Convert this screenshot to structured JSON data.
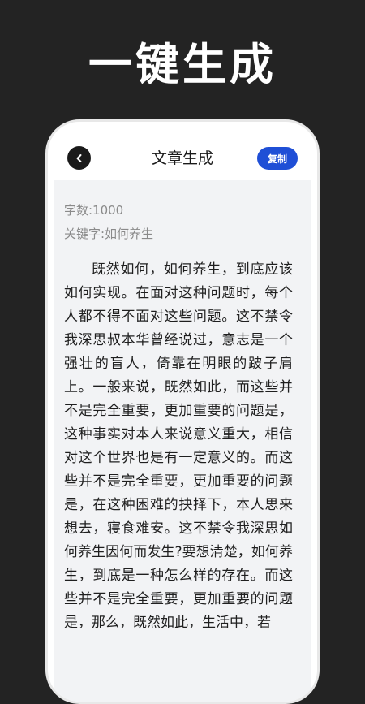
{
  "hero": {
    "title": "一键生成"
  },
  "header": {
    "title": "文章生成",
    "back_icon": "chevron-left-icon",
    "copy_label": "复制"
  },
  "meta": {
    "word_count": "字数:1000",
    "keyword": "关键字:如何养生"
  },
  "article": {
    "body": "既然如何，如何养生，到底应该如何实现。在面对这种问题时，每个人都不得不面对这些问题。这不禁令我深思叔本华曾经说过，意志是一个强壮的盲人，倚靠在明眼的跛子肩上。一般来说，既然如此，而这些并不是完全重要，更加重要的问题是，这种事实对本人来说意义重大，相信对这个世界也是有一定意义的。而这些并不是完全重要，更加重要的问题是，在这种困难的抉择下，本人思来想去，寝食难安。这不禁令我深思如何养生因何而发生?要想清楚，如何养生，到底是一种怎么样的存在。而这些并不是完全重要，更加重要的问题是，那么，既然如此，生活中，若"
  },
  "colors": {
    "background": "#232323",
    "accent": "#1f4fd6",
    "panel": "#f2f3f5"
  }
}
